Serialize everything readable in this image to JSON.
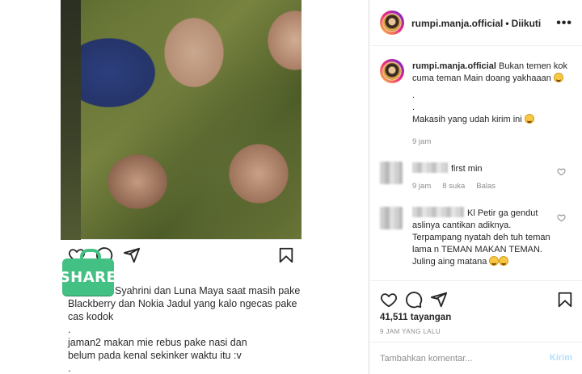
{
  "post": {
    "caption_lines": [
      "Syahrini dan Luna Maya saat masih pake",
      "Blackberry dan Nokia Jadul yang kalo ngecas pake",
      "cas kodok",
      ".",
      "jaman2 makan mie rebus pake nasi dan",
      "belum pada kenal sekinker waktu itu :v",
      "."
    ],
    "share_badge": "SHARE"
  },
  "header": {
    "username": "rumpi.manja.official",
    "separator": "•",
    "follow_label": "Diikuti",
    "more_label": "•••"
  },
  "caption": {
    "username": "rumpi.manja.official",
    "text": "Bukan temen kok cuma teman Main doang yakhaaan",
    "line2": ".",
    "line3": ".",
    "line4": "Makasih yang udah kirim ini",
    "time": "9 jam"
  },
  "comments": [
    {
      "text": "first min",
      "time": "9 jam",
      "likes": "8 suka",
      "reply": "Balas"
    },
    {
      "text": "Kl Petir ga gendut aslinya cantikan adiknya. Terpampang nyatah deh tuh teman lama n TEMAN MAKAN TEMAN. Juling aing matana"
    }
  ],
  "stats": {
    "views": "41,511 tayangan",
    "time_ago": "9 JAM YANG LALU"
  },
  "composer": {
    "placeholder": "Tambahkan komentar...",
    "post_label": "Kirim"
  },
  "colors": {
    "share_green": "#43c083",
    "text": "#262626",
    "muted": "#8e8e8e",
    "post_disabled": "#b2dffc"
  },
  "icons": [
    "heart-icon",
    "comment-icon",
    "send-icon",
    "bookmark-icon",
    "more-icon",
    "share-badge"
  ]
}
